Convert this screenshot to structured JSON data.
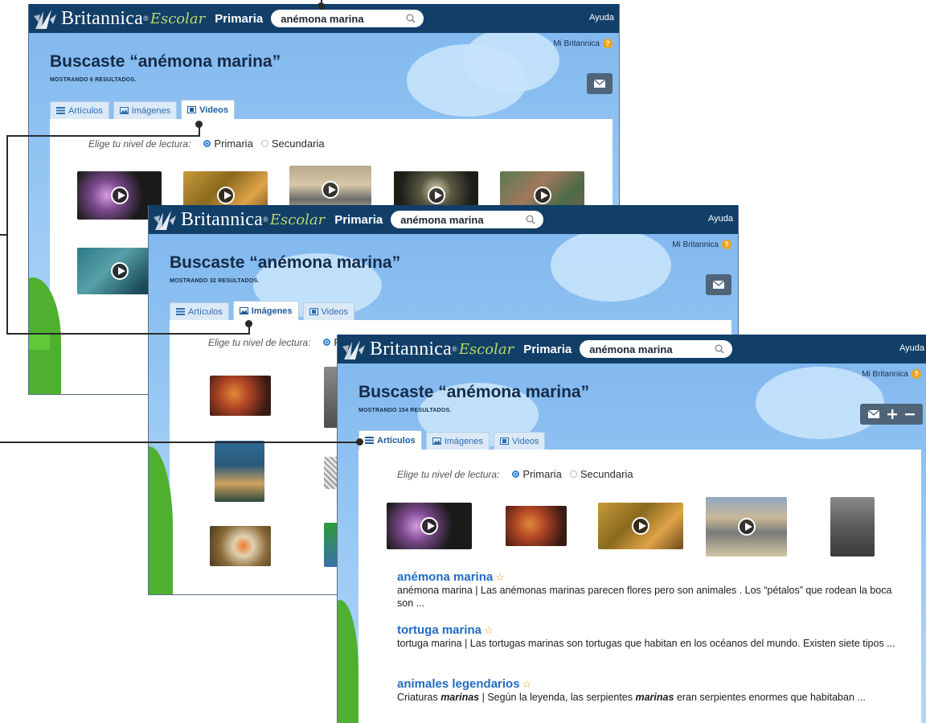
{
  "brand": {
    "name": "Britannica",
    "sup": "®",
    "sub": "Escolar",
    "level": "Primaria"
  },
  "search": {
    "value": "anémona marina"
  },
  "nav": {
    "help": "Ayuda",
    "my_britannica": "Mi Britannica",
    "help_badge": "?"
  },
  "tabs": {
    "articles": "Artículos",
    "images": "Imágenes",
    "videos": "Videos"
  },
  "level": {
    "label": "Elige tu nivel de lectura:",
    "primary": "Primaria",
    "secondary": "Secundaria"
  },
  "windows": [
    {
      "title": "Buscaste “anémona marina”",
      "count": "MOSTRANDO 6 RESULTADOS.",
      "active_tab": "Videos"
    },
    {
      "title": "Buscaste “anémona marina”",
      "count": "MOSTRANDO 32 RESULTADOS.",
      "active_tab": "Imágenes"
    },
    {
      "title": "Buscaste “anémona marina”",
      "count": "MOSTRANDO 154 RESULTADOS.",
      "active_tab": "Artículos"
    }
  ],
  "level_truncated": "Pr",
  "results": [
    {
      "title": "anémona marina",
      "desc": "anémona marina  |  Las anémonas marinas parecen flores pero son animales . Los “pétalos” que rodean la boca son ..."
    },
    {
      "title": "tortuga marina",
      "desc": "tortuga marina  |  Las tortugas marinas son tortugas que habitan en los océanos del mundo. Existen siete tipos ..."
    },
    {
      "title": "animales legendarios",
      "desc_pre": "Criaturas ",
      "desc_em": "marinas",
      "desc_mid": "  | Según la leyenda, las serpientes ",
      "desc_em2": "marinas",
      "desc_post": " eran serpientes enormes que habitaban ..."
    }
  ],
  "icons": [
    "search-icon",
    "mail-icon",
    "plus-icon",
    "minus-icon",
    "list-icon",
    "image-icon",
    "film-icon",
    "star-icon",
    "play-icon",
    "thistle-logo-icon"
  ]
}
